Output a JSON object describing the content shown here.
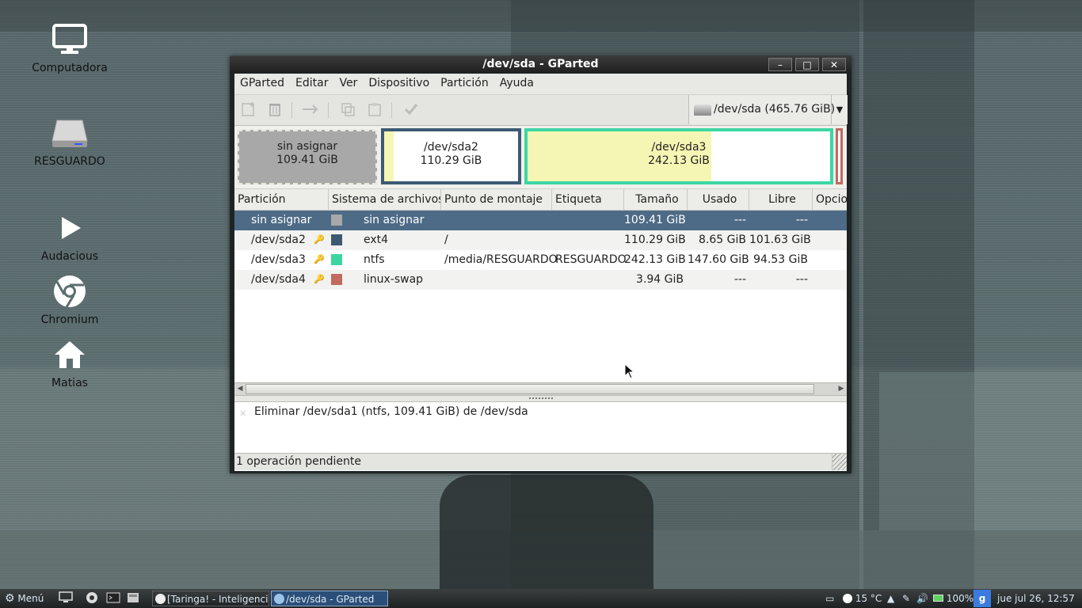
{
  "desktop": {
    "icons": [
      {
        "label": "Computadora"
      },
      {
        "label": "RESGUARDO"
      },
      {
        "label": "Audacious"
      },
      {
        "label": "Chromium"
      },
      {
        "label": "Matias"
      }
    ]
  },
  "window": {
    "title": "/dev/sda - GParted",
    "controls": {
      "minimize": "–",
      "maximize": "□",
      "close": "✕"
    }
  },
  "menubar": [
    "GParted",
    "Editar",
    "Ver",
    "Dispositivo",
    "Partición",
    "Ayuda"
  ],
  "toolbar": {
    "device_selector": "/dev/sda  (465.76 GiB)"
  },
  "graph": {
    "partitions": [
      {
        "name": "sin asignar",
        "size": "109.41 GiB"
      },
      {
        "name": "/dev/sda2",
        "size": "110.29 GiB"
      },
      {
        "name": "/dev/sda3",
        "size": "242.13 GiB"
      }
    ]
  },
  "table": {
    "columns": [
      "Partición",
      "Sistema de archivos",
      "Punto de montaje",
      "Etiqueta",
      "Tamaño",
      "Usado",
      "Libre",
      "Opcio"
    ],
    "rows": [
      {
        "partition": "sin asignar",
        "fs": "sin asignar",
        "mount": "",
        "label": "",
        "size": "109.41 GiB",
        "used": "---",
        "free": "---",
        "color": "#a8a8a8"
      },
      {
        "partition": "/dev/sda2",
        "fs": "ext4",
        "mount": "/",
        "label": "",
        "size": "110.29 GiB",
        "used": "8.65 GiB",
        "free": "101.63 GiB",
        "color": "#3d5a73"
      },
      {
        "partition": "/dev/sda3",
        "fs": "ntfs",
        "mount": "/media/RESGUARDO",
        "label": "RESGUARDO",
        "size": "242.13 GiB",
        "used": "147.60 GiB",
        "free": "94.53 GiB",
        "color": "#3dd6a3"
      },
      {
        "partition": "/dev/sda4",
        "fs": "linux-swap",
        "mount": "",
        "label": "",
        "size": "3.94 GiB",
        "used": "---",
        "free": "---",
        "color": "#c06a60"
      }
    ]
  },
  "operations": [
    "Eliminar /dev/sda1 (ntfs, 109.41 GiB) de /dev/sda"
  ],
  "status": "1 operación pendiente",
  "taskbar": {
    "menu": "Menú",
    "tasks": [
      "[Taringa! - Inteligenci...",
      "/dev/sda - GParted"
    ],
    "weather": "15 °C",
    "battery": "100%",
    "clock": "jue jul 26, 12:57"
  }
}
